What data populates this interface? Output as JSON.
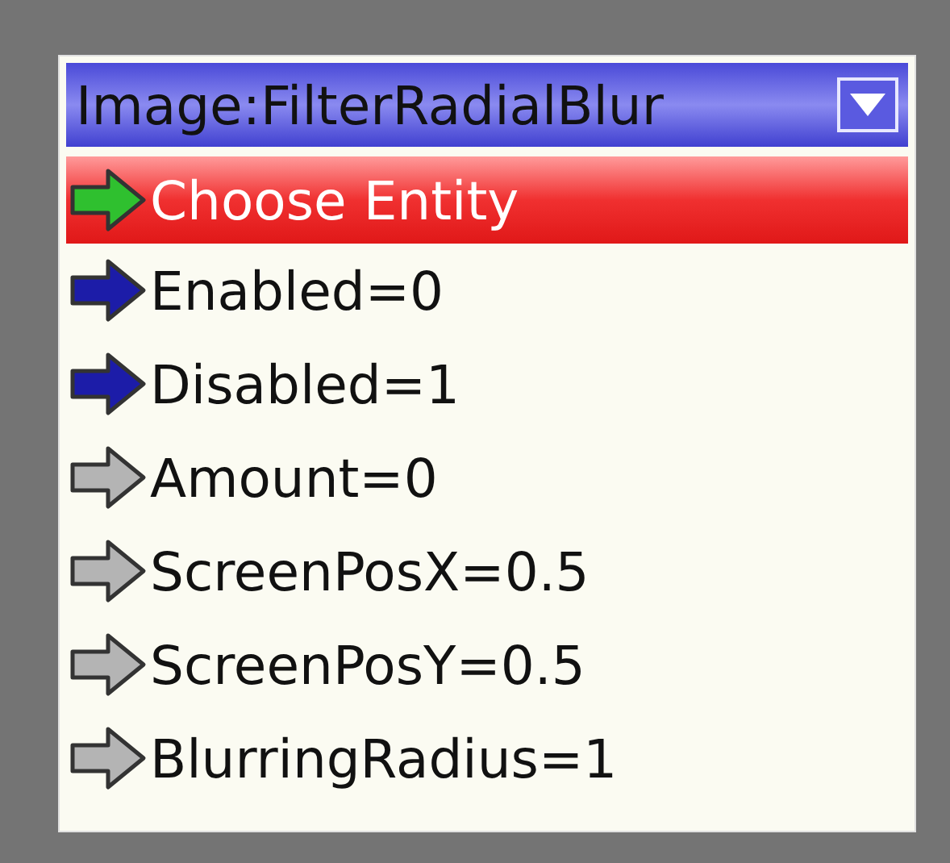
{
  "node": {
    "title": "Image:FilterRadialBlur",
    "items": [
      {
        "label": "Choose Entity",
        "selected": true,
        "color": "#2fc02f"
      },
      {
        "label": "Enabled=0",
        "selected": false,
        "color": "#1c1ca8"
      },
      {
        "label": "Disabled=1",
        "selected": false,
        "color": "#1c1ca8"
      },
      {
        "label": "Amount=0",
        "selected": false,
        "color": "#b4b4b4"
      },
      {
        "label": "ScreenPosX=0.5",
        "selected": false,
        "color": "#b4b4b4"
      },
      {
        "label": "ScreenPosY=0.5",
        "selected": false,
        "color": "#b4b4b4"
      },
      {
        "label": "BlurringRadius=1",
        "selected": false,
        "color": "#b4b4b4"
      }
    ]
  }
}
